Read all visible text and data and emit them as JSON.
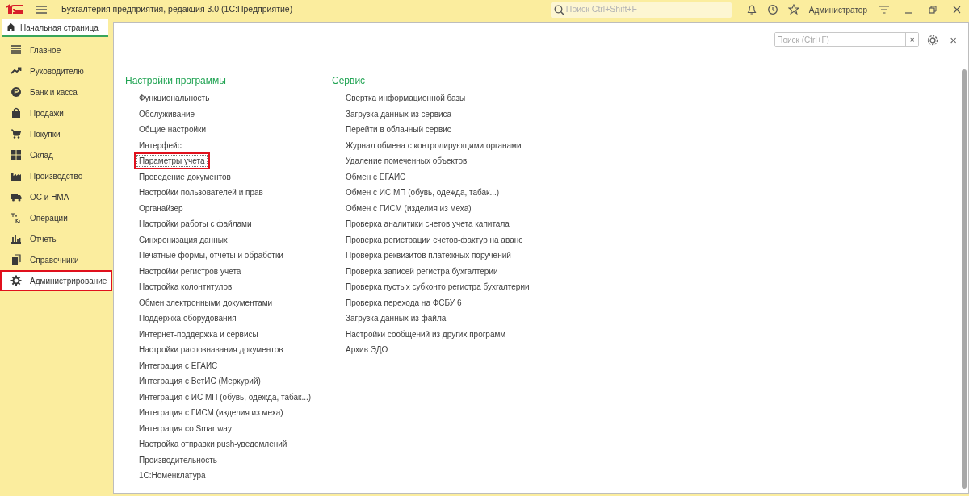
{
  "window": {
    "title": "Бухгалтерия предприятия, редакция 3.0  (1С:Предприятие)",
    "search_placeholder": "Поиск Ctrl+Shift+F",
    "user": "Администратор"
  },
  "home_tab": {
    "label": "Начальная страница",
    "selected": true
  },
  "sidebar": {
    "items": [
      {
        "label": "Главное",
        "selected": false,
        "highlighted": false
      },
      {
        "label": "Руководителю",
        "selected": false,
        "highlighted": false
      },
      {
        "label": "Банк и касса",
        "selected": false,
        "highlighted": false
      },
      {
        "label": "Продажи",
        "selected": false,
        "highlighted": false
      },
      {
        "label": "Покупки",
        "selected": false,
        "highlighted": false
      },
      {
        "label": "Склад",
        "selected": false,
        "highlighted": false
      },
      {
        "label": "Производство",
        "selected": false,
        "highlighted": false
      },
      {
        "label": "ОС и НМА",
        "selected": false,
        "highlighted": false
      },
      {
        "label": "Операции",
        "selected": false,
        "highlighted": false
      },
      {
        "label": "Отчеты",
        "selected": false,
        "highlighted": false
      },
      {
        "label": "Справочники",
        "selected": false,
        "highlighted": false
      },
      {
        "label": "Администрирование",
        "selected": true,
        "highlighted": true
      }
    ]
  },
  "content": {
    "search_placeholder": "Поиск (Ctrl+F)",
    "clear": "×",
    "close": "×",
    "sections": [
      {
        "title": "Настройки программы",
        "links": [
          {
            "label": "Функциональность",
            "highlighted": false
          },
          {
            "label": "Обслуживание",
            "highlighted": false
          },
          {
            "label": "Общие настройки",
            "highlighted": false
          },
          {
            "label": "Интерфейс",
            "highlighted": false
          },
          {
            "label": "Параметры учета",
            "highlighted": true
          },
          {
            "label": "Проведение документов",
            "highlighted": false
          },
          {
            "label": "Настройки пользователей и прав",
            "highlighted": false
          },
          {
            "label": "Органайзер",
            "highlighted": false
          },
          {
            "label": "Настройки работы с файлами",
            "highlighted": false
          },
          {
            "label": "Синхронизация данных",
            "highlighted": false
          },
          {
            "label": "Печатные формы, отчеты и обработки",
            "highlighted": false
          },
          {
            "label": "Настройки регистров учета",
            "highlighted": false
          },
          {
            "label": "Настройка колонтитулов",
            "highlighted": false
          },
          {
            "label": "Обмен электронными документами",
            "highlighted": false
          },
          {
            "label": "Поддержка оборудования",
            "highlighted": false
          },
          {
            "label": "Интернет-поддержка и сервисы",
            "highlighted": false
          },
          {
            "label": "Настройки распознавания документов",
            "highlighted": false
          },
          {
            "label": "Интеграция с ЕГАИС",
            "highlighted": false
          },
          {
            "label": "Интеграция с ВетИС (Меркурий)",
            "highlighted": false
          },
          {
            "label": "Интеграция с ИС МП (обувь, одежда, табак...)",
            "highlighted": false
          },
          {
            "label": "Интеграция с ГИСМ (изделия из меха)",
            "highlighted": false
          },
          {
            "label": "Интеграция со Smartway",
            "highlighted": false
          },
          {
            "label": "Настройка отправки push-уведомлений",
            "highlighted": false
          },
          {
            "label": "Производительность",
            "highlighted": false
          },
          {
            "label": "1С:Номенклатура",
            "highlighted": false
          }
        ]
      },
      {
        "title": "Сервис",
        "links": [
          {
            "label": "Свертка информационной базы",
            "highlighted": false
          },
          {
            "label": "Загрузка данных из сервиса",
            "highlighted": false
          },
          {
            "label": "Перейти в облачный сервис",
            "highlighted": false
          },
          {
            "label": "Журнал обмена с контролирующими органами",
            "highlighted": false
          },
          {
            "label": "Удаление помеченных объектов",
            "highlighted": false
          },
          {
            "label": "Обмен с ЕГАИС",
            "highlighted": false
          },
          {
            "label": "Обмен с ИС МП (обувь, одежда, табак...)",
            "highlighted": false
          },
          {
            "label": "Обмен с ГИСМ (изделия из меха)",
            "highlighted": false
          },
          {
            "label": "Проверка аналитики счетов учета капитала",
            "highlighted": false
          },
          {
            "label": "Проверка регистрации счетов-фактур на аванс",
            "highlighted": false
          },
          {
            "label": "Проверка реквизитов платежных поручений",
            "highlighted": false
          },
          {
            "label": "Проверка записей регистра бухгалтерии",
            "highlighted": false
          },
          {
            "label": "Проверка пустых субконто регистра бухгалтерии",
            "highlighted": false
          },
          {
            "label": "Проверка перехода на ФСБУ 6",
            "highlighted": false
          },
          {
            "label": "Загрузка данных из файла",
            "highlighted": false
          },
          {
            "label": "Настройки сообщений из других программ",
            "highlighted": false
          },
          {
            "label": "Архив ЭДО",
            "highlighted": false
          }
        ]
      }
    ]
  }
}
